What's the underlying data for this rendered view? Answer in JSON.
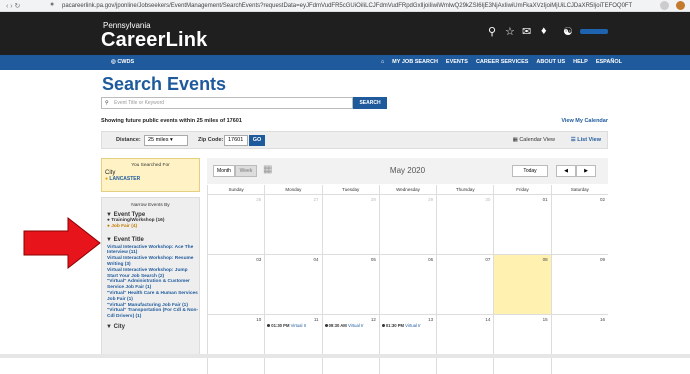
{
  "browser": {
    "nav": "‹ › ↻",
    "url": "pacareerlink.pa.gov/jponline/Jobseekers/EventManagement/SearchEvents?requestData=eyJFdmVudFR5cGUiOiIiLCJFdmVudFRpdGxlIjoiIiwiWmlwQ29kZSI6IjE3NjAxIiwiUmFkaXVzIjoiMjUiLCJDaXR5IjoiTEFOQ0FTVEVSIiwiQ291bnR5SWQiOiIifQ"
  },
  "header": {
    "logo_small": "Pennsylvania",
    "logo_big": "CareerLink",
    "icons": [
      "search-icon",
      "star-icon",
      "mail-icon",
      "bell-icon",
      "user-icon"
    ]
  },
  "navbar": {
    "cwds": "◎ CWDS",
    "links": [
      "⌂",
      "MY JOB SEARCH",
      "EVENTS",
      "CAREER SERVICES",
      "ABOUT US",
      "HELP",
      "ESPAÑOL"
    ]
  },
  "page": {
    "title": "Search Events",
    "search_placeholder": "Event Title or Keyword",
    "search_button": "SEARCH",
    "showing_text": "Showing future public events within 25 miles of 17601",
    "my_calendar": "View My Calendar",
    "distance_label": "Distance:",
    "distance_value": "25 miles",
    "zip_label": "Zip Code:",
    "zip_value": "17601",
    "go_button": "GO",
    "calendar_view": "Calendar View",
    "list_view": "List View"
  },
  "sidebar": {
    "searched_header": "You Searched For",
    "searched_label": "City",
    "searched_value": "LANCASTER",
    "narrow_header": "Narrow Events By",
    "event_type_header": "▼ Event Type",
    "event_types": [
      "● Training/Workshop (16)",
      "● Job Fair (4)"
    ],
    "event_title_header": "▼ Event Title",
    "event_titles": [
      "Virtual Interactive Workshop: Ace The Interview (11)",
      "Virtual Interactive Workshop: Resume Writing (3)",
      "Virtual Interactive Workshop: Jump Start Your Job Search (2)",
      "\"Virtual\" Administration & Customer Service Job Fair (1)",
      "\"Virtual\" Health Care & Human Services Job Fair (1)",
      "\"Virtual\" Manufacturing Job Fair (1)",
      "\"Virtual\" Transportation (For Cdl & Non-Cdl Drivers) (1)"
    ],
    "city_header": "▼ City"
  },
  "calendar": {
    "month_button": "Month",
    "week_button": "Week",
    "title": "May 2020",
    "today_button": "Today",
    "prev": "◀",
    "next": "▶",
    "weekdays": [
      "Sunday",
      "Monday",
      "Tuesday",
      "Wednesday",
      "Thursday",
      "Friday",
      "Saturday"
    ],
    "weeks": [
      [
        "26",
        "27",
        "28",
        "29",
        "30",
        "01",
        "02"
      ],
      [
        "03",
        "04",
        "05",
        "06",
        "07",
        "08",
        "09"
      ],
      [
        "10",
        "11",
        "12",
        "13",
        "14",
        "15",
        "16"
      ]
    ],
    "events": [
      {
        "time": "01:30 PM",
        "title": "Virtual Ir"
      },
      {
        "time": "09:30 AM",
        "title": "Virtual Ir"
      },
      {
        "time": "01:30 PM",
        "title": "Virtual Ir"
      }
    ]
  }
}
